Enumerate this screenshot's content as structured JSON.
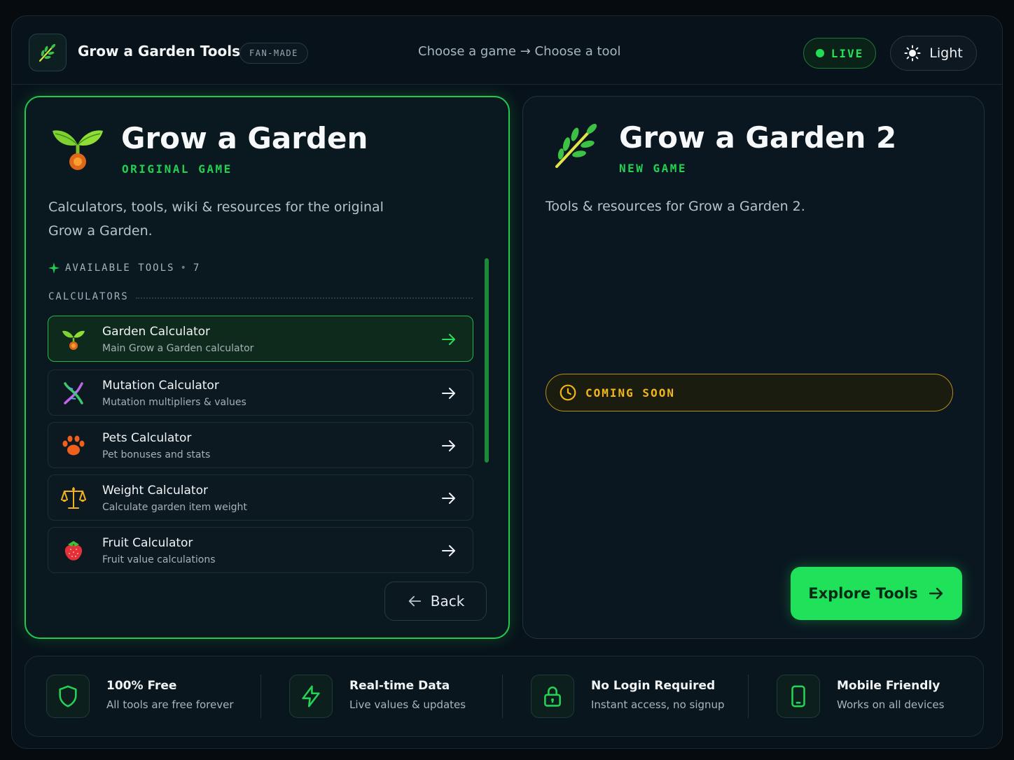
{
  "header": {
    "brand": "Grow a Garden Tools",
    "badge": "FAN-MADE",
    "hint": "Choose a game → Choose a tool",
    "live_label": "LIVE",
    "theme_label": "Light"
  },
  "games": [
    {
      "title": "Grow a Garden",
      "tag": "ORIGINAL GAME",
      "description": "Calculators, tools, wiki & resources for the original Grow a Garden.",
      "available_label": "AVAILABLE TOOLS",
      "available_separator": "•",
      "available_count": "7",
      "section": "CALCULATORS",
      "tools": [
        {
          "name": "Garden Calculator",
          "sub": "Main Grow a Garden calculator",
          "icon": "seedling-icon"
        },
        {
          "name": "Mutation Calculator",
          "sub": "Mutation multipliers & values",
          "icon": "dna-icon"
        },
        {
          "name": "Pets Calculator",
          "sub": "Pet bonuses and stats",
          "icon": "paw-icon"
        },
        {
          "name": "Weight Calculator",
          "sub": "Calculate garden item weight",
          "icon": "scale-icon"
        },
        {
          "name": "Fruit Calculator",
          "sub": "Fruit value calculations",
          "icon": "strawberry-icon"
        }
      ],
      "back_label": "Back"
    },
    {
      "title": "Grow a Garden 2",
      "tag": "NEW GAME",
      "description": "Tools & resources for Grow a Garden 2.",
      "coming_label": "COMING SOON",
      "explore_label": "Explore Tools"
    }
  ],
  "features": [
    {
      "title": "100% Free",
      "sub": "All tools are free forever",
      "icon": "shield-icon"
    },
    {
      "title": "Real-time Data",
      "sub": "Live values & updates",
      "icon": "lightning-icon"
    },
    {
      "title": "No Login Required",
      "sub": "Instant access, no signup",
      "icon": "lock-icon"
    },
    {
      "title": "Mobile Friendly",
      "sub": "Works on all devices",
      "icon": "phone-icon"
    }
  ],
  "colors": {
    "accent": "#22c94e",
    "warning": "#f1b718",
    "background": "#060b10"
  }
}
